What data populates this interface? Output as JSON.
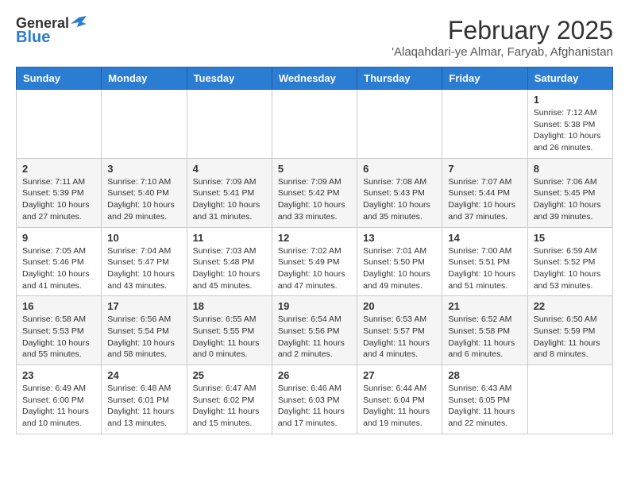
{
  "header": {
    "logo_general": "General",
    "logo_blue": "Blue",
    "month_title": "February 2025",
    "location": "'Alaqahdari-ye Almar, Faryab, Afghanistan"
  },
  "weekdays": [
    "Sunday",
    "Monday",
    "Tuesday",
    "Wednesday",
    "Thursday",
    "Friday",
    "Saturday"
  ],
  "weeks": [
    [
      {
        "day": "",
        "info": ""
      },
      {
        "day": "",
        "info": ""
      },
      {
        "day": "",
        "info": ""
      },
      {
        "day": "",
        "info": ""
      },
      {
        "day": "",
        "info": ""
      },
      {
        "day": "",
        "info": ""
      },
      {
        "day": "1",
        "info": "Sunrise: 7:12 AM\nSunset: 5:38 PM\nDaylight: 10 hours and 26 minutes."
      }
    ],
    [
      {
        "day": "2",
        "info": "Sunrise: 7:11 AM\nSunset: 5:39 PM\nDaylight: 10 hours and 27 minutes."
      },
      {
        "day": "3",
        "info": "Sunrise: 7:10 AM\nSunset: 5:40 PM\nDaylight: 10 hours and 29 minutes."
      },
      {
        "day": "4",
        "info": "Sunrise: 7:09 AM\nSunset: 5:41 PM\nDaylight: 10 hours and 31 minutes."
      },
      {
        "day": "5",
        "info": "Sunrise: 7:09 AM\nSunset: 5:42 PM\nDaylight: 10 hours and 33 minutes."
      },
      {
        "day": "6",
        "info": "Sunrise: 7:08 AM\nSunset: 5:43 PM\nDaylight: 10 hours and 35 minutes."
      },
      {
        "day": "7",
        "info": "Sunrise: 7:07 AM\nSunset: 5:44 PM\nDaylight: 10 hours and 37 minutes."
      },
      {
        "day": "8",
        "info": "Sunrise: 7:06 AM\nSunset: 5:45 PM\nDaylight: 10 hours and 39 minutes."
      }
    ],
    [
      {
        "day": "9",
        "info": "Sunrise: 7:05 AM\nSunset: 5:46 PM\nDaylight: 10 hours and 41 minutes."
      },
      {
        "day": "10",
        "info": "Sunrise: 7:04 AM\nSunset: 5:47 PM\nDaylight: 10 hours and 43 minutes."
      },
      {
        "day": "11",
        "info": "Sunrise: 7:03 AM\nSunset: 5:48 PM\nDaylight: 10 hours and 45 minutes."
      },
      {
        "day": "12",
        "info": "Sunrise: 7:02 AM\nSunset: 5:49 PM\nDaylight: 10 hours and 47 minutes."
      },
      {
        "day": "13",
        "info": "Sunrise: 7:01 AM\nSunset: 5:50 PM\nDaylight: 10 hours and 49 minutes."
      },
      {
        "day": "14",
        "info": "Sunrise: 7:00 AM\nSunset: 5:51 PM\nDaylight: 10 hours and 51 minutes."
      },
      {
        "day": "15",
        "info": "Sunrise: 6:59 AM\nSunset: 5:52 PM\nDaylight: 10 hours and 53 minutes."
      }
    ],
    [
      {
        "day": "16",
        "info": "Sunrise: 6:58 AM\nSunset: 5:53 PM\nDaylight: 10 hours and 55 minutes."
      },
      {
        "day": "17",
        "info": "Sunrise: 6:56 AM\nSunset: 5:54 PM\nDaylight: 10 hours and 58 minutes."
      },
      {
        "day": "18",
        "info": "Sunrise: 6:55 AM\nSunset: 5:55 PM\nDaylight: 11 hours and 0 minutes."
      },
      {
        "day": "19",
        "info": "Sunrise: 6:54 AM\nSunset: 5:56 PM\nDaylight: 11 hours and 2 minutes."
      },
      {
        "day": "20",
        "info": "Sunrise: 6:53 AM\nSunset: 5:57 PM\nDaylight: 11 hours and 4 minutes."
      },
      {
        "day": "21",
        "info": "Sunrise: 6:52 AM\nSunset: 5:58 PM\nDaylight: 11 hours and 6 minutes."
      },
      {
        "day": "22",
        "info": "Sunrise: 6:50 AM\nSunset: 5:59 PM\nDaylight: 11 hours and 8 minutes."
      }
    ],
    [
      {
        "day": "23",
        "info": "Sunrise: 6:49 AM\nSunset: 6:00 PM\nDaylight: 11 hours and 10 minutes."
      },
      {
        "day": "24",
        "info": "Sunrise: 6:48 AM\nSunset: 6:01 PM\nDaylight: 11 hours and 13 minutes."
      },
      {
        "day": "25",
        "info": "Sunrise: 6:47 AM\nSunset: 6:02 PM\nDaylight: 11 hours and 15 minutes."
      },
      {
        "day": "26",
        "info": "Sunrise: 6:46 AM\nSunset: 6:03 PM\nDaylight: 11 hours and 17 minutes."
      },
      {
        "day": "27",
        "info": "Sunrise: 6:44 AM\nSunset: 6:04 PM\nDaylight: 11 hours and 19 minutes."
      },
      {
        "day": "28",
        "info": "Sunrise: 6:43 AM\nSunset: 6:05 PM\nDaylight: 11 hours and 22 minutes."
      },
      {
        "day": "",
        "info": ""
      }
    ]
  ]
}
